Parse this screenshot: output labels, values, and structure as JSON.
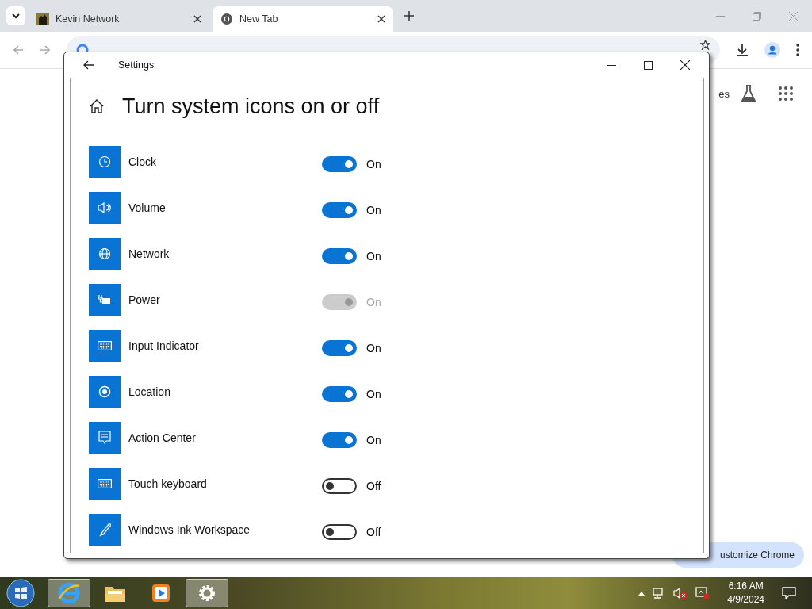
{
  "browser": {
    "tabs": [
      {
        "title": "Kevin Network",
        "kind": "site",
        "selected": false
      },
      {
        "title": "New Tab",
        "kind": "chrome",
        "selected": true
      }
    ],
    "shortcut_fragment": "es",
    "customize_button": "ustomize Chrome"
  },
  "settings_window": {
    "title": "Settings",
    "heading": "Turn system icons on or off",
    "items": [
      {
        "label": "Clock",
        "kind": "clock",
        "on": true,
        "disabled": false,
        "state": "On"
      },
      {
        "label": "Volume",
        "kind": "volume",
        "on": true,
        "disabled": false,
        "state": "On"
      },
      {
        "label": "Network",
        "kind": "network",
        "on": true,
        "disabled": false,
        "state": "On"
      },
      {
        "label": "Power",
        "kind": "power",
        "on": true,
        "disabled": true,
        "state": "On"
      },
      {
        "label": "Input Indicator",
        "kind": "keyboard",
        "on": true,
        "disabled": false,
        "state": "On"
      },
      {
        "label": "Location",
        "kind": "location",
        "on": true,
        "disabled": false,
        "state": "On"
      },
      {
        "label": "Action Center",
        "kind": "message",
        "on": true,
        "disabled": false,
        "state": "On"
      },
      {
        "label": "Touch keyboard",
        "kind": "keyboard",
        "on": false,
        "disabled": false,
        "state": "Off"
      },
      {
        "label": "Windows Ink Workspace",
        "kind": "pen",
        "on": false,
        "disabled": false,
        "state": "Off"
      }
    ]
  },
  "taskbar": {
    "apps": [
      {
        "kind": "browser",
        "selected": true
      },
      {
        "kind": "folder",
        "selected": false
      },
      {
        "kind": "media",
        "selected": false
      },
      {
        "kind": "settings",
        "selected": true
      }
    ],
    "time": "6:16 AM",
    "date": "4/9/2024"
  }
}
